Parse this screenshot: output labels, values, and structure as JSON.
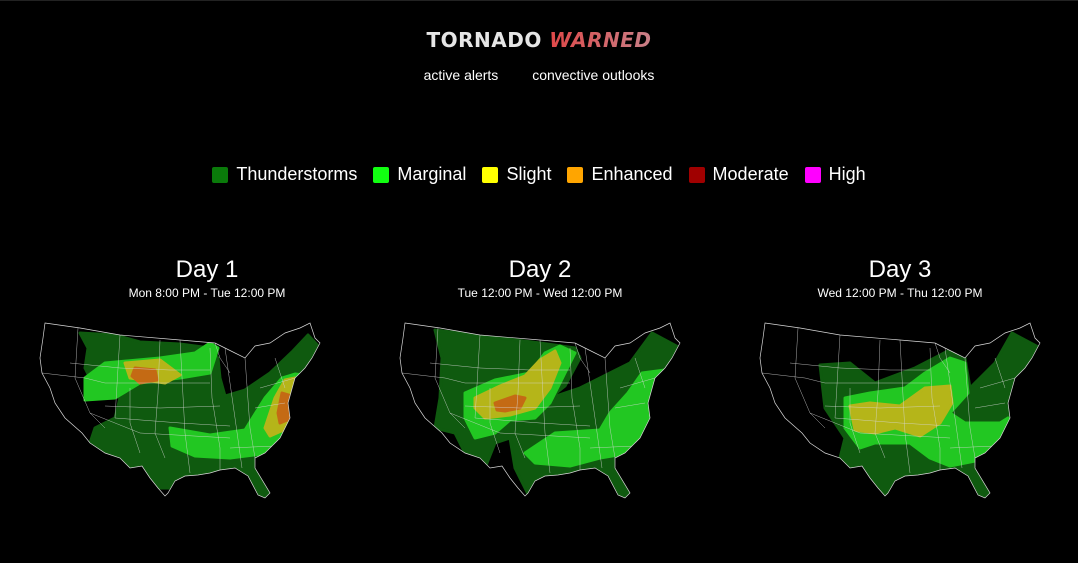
{
  "header": {
    "logo_part1": "TORNADO",
    "logo_part2": "WARNED",
    "nav": [
      {
        "label": "active alerts"
      },
      {
        "label": "convective outlooks"
      }
    ]
  },
  "legend": [
    {
      "label": "Thunderstorms",
      "color": "#0a7a0a"
    },
    {
      "label": "Marginal",
      "color": "#11ff11"
    },
    {
      "label": "Slight",
      "color": "#ffff00"
    },
    {
      "label": "Enhanced",
      "color": "#ffa500"
    },
    {
      "label": "Moderate",
      "color": "#a00000"
    },
    {
      "label": "High",
      "color": "#ff00ff"
    }
  ],
  "map_colors": {
    "thunderstorms": "#0f5a0f",
    "marginal": "#22c722",
    "slight": "#b5b519",
    "enhanced": "#c46a14",
    "moderate": "#a00000",
    "state_lines": "#d8d8d8"
  },
  "days": [
    {
      "title": "Day 1",
      "range": "Mon 8:00 PM - Tue 12:00 PM",
      "regions": {
        "thunderstorms": [
          [
            [
              50,
              15
            ],
            [
              85,
              17
            ],
            [
              110,
              24
            ],
            [
              150,
              26
            ],
            [
              180,
              30
            ],
            [
              188,
              40
            ],
            [
              190,
              60
            ],
            [
              195,
              78
            ],
            [
              215,
              72
            ],
            [
              240,
              55
            ],
            [
              262,
              34
            ],
            [
              278,
              17
            ],
            [
              290,
              30
            ],
            [
              285,
              60
            ],
            [
              270,
              100
            ],
            [
              240,
              140
            ],
            [
              245,
              160
            ],
            [
              240,
              180
            ],
            [
              228,
              185
            ],
            [
              215,
              160
            ],
            [
              190,
              158
            ],
            [
              160,
              158
            ],
            [
              140,
              170
            ],
            [
              115,
              170
            ],
            [
              95,
              165
            ],
            [
              75,
              140
            ],
            [
              55,
              140
            ],
            [
              65,
              110
            ],
            [
              85,
              100
            ],
            [
              90,
              80
            ],
            [
              65,
              70
            ],
            [
              55,
              50
            ],
            [
              58,
              30
            ]
          ]
        ],
        "marginal": [
          [
            [
              75,
              45
            ],
            [
              130,
              40
            ],
            [
              165,
              35
            ],
            [
              180,
              25
            ],
            [
              188,
              30
            ],
            [
              180,
              55
            ],
            [
              150,
              60
            ],
            [
              110,
              65
            ],
            [
              85,
              80
            ],
            [
              55,
              82
            ],
            [
              55,
              60
            ]
          ],
          [
            [
              140,
              110
            ],
            [
              180,
              117
            ],
            [
              215,
              112
            ],
            [
              235,
              80
            ],
            [
              252,
              60
            ],
            [
              265,
              56
            ],
            [
              282,
              58
            ],
            [
              278,
              80
            ],
            [
              265,
              105
            ],
            [
              240,
              135
            ],
            [
              200,
              140
            ],
            [
              165,
              138
            ],
            [
              142,
              128
            ]
          ]
        ],
        "slight": [
          [
            [
              95,
              45
            ],
            [
              130,
              42
            ],
            [
              150,
              57
            ],
            [
              135,
              65
            ],
            [
              100,
              60
            ]
          ],
          [
            [
              235,
              110
            ],
            [
              245,
              80
            ],
            [
              255,
              62
            ],
            [
              265,
              60
            ],
            [
              268,
              85
            ],
            [
              258,
              110
            ],
            [
              240,
              118
            ]
          ]
        ],
        "enhanced": [
          [
            [
              105,
              50
            ],
            [
              125,
              52
            ],
            [
              127,
              62
            ],
            [
              110,
              65
            ],
            [
              102,
              58
            ]
          ],
          [
            [
              248,
              95
            ],
            [
              252,
              75
            ],
            [
              262,
              78
            ],
            [
              262,
              100
            ],
            [
              250,
              105
            ]
          ]
        ],
        "moderate": []
      }
    },
    {
      "title": "Day 2",
      "range": "Tue 12:00 PM - Wed 12:00 PM",
      "regions": {
        "thunderstorms": [
          [
            [
              45,
              12
            ],
            [
              110,
              20
            ],
            [
              150,
              25
            ],
            [
              185,
              30
            ],
            [
              190,
              40
            ],
            [
              175,
              68
            ],
            [
              160,
              80
            ],
            [
              190,
              70
            ],
            [
              220,
              55
            ],
            [
              240,
              45
            ],
            [
              262,
              15
            ],
            [
              290,
              30
            ],
            [
              285,
              60
            ],
            [
              270,
              100
            ],
            [
              250,
              135
            ],
            [
              245,
              160
            ],
            [
              240,
              185
            ],
            [
              225,
              180
            ],
            [
              210,
              158
            ],
            [
              190,
              158
            ],
            [
              175,
              160
            ],
            [
              145,
              175
            ],
            [
              140,
              180
            ],
            [
              125,
              150
            ],
            [
              120,
              120
            ],
            [
              105,
              125
            ],
            [
              95,
              150
            ],
            [
              75,
              135
            ],
            [
              65,
              115
            ],
            [
              45,
              110
            ],
            [
              50,
              80
            ],
            [
              52,
              40
            ]
          ]
        ],
        "marginal": [
          [
            [
              75,
              75
            ],
            [
              105,
              62
            ],
            [
              140,
              55
            ],
            [
              155,
              35
            ],
            [
              170,
              28
            ],
            [
              185,
              35
            ],
            [
              175,
              55
            ],
            [
              160,
              85
            ],
            [
              145,
              100
            ],
            [
              120,
              102
            ],
            [
              105,
              115
            ],
            [
              85,
              120
            ],
            [
              75,
              100
            ]
          ],
          [
            [
              135,
              135
            ],
            [
              165,
              115
            ],
            [
              210,
              112
            ],
            [
              220,
              95
            ],
            [
              238,
              75
            ],
            [
              252,
              55
            ],
            [
              275,
              52
            ],
            [
              270,
              80
            ],
            [
              255,
              110
            ],
            [
              240,
              135
            ],
            [
              210,
              140
            ],
            [
              180,
              148
            ],
            [
              145,
              145
            ]
          ]
        ],
        "slight": [
          [
            [
              85,
              80
            ],
            [
              110,
              68
            ],
            [
              135,
              58
            ],
            [
              150,
              42
            ],
            [
              165,
              33
            ],
            [
              170,
              45
            ],
            [
              160,
              70
            ],
            [
              145,
              90
            ],
            [
              120,
              97
            ],
            [
              95,
              100
            ],
            [
              85,
              90
            ]
          ]
        ],
        "enhanced": [
          [
            [
              105,
              85
            ],
            [
              125,
              78
            ],
            [
              135,
              80
            ],
            [
              130,
              90
            ],
            [
              115,
              93
            ],
            [
              107,
              92
            ]
          ]
        ],
        "moderate": []
      }
    },
    {
      "title": "Day 3",
      "range": "Wed 12:00 PM - Thu 12:00 PM",
      "regions": {
        "thunderstorms": [
          [
            [
              70,
              47
            ],
            [
              100,
              45
            ],
            [
              125,
              65
            ],
            [
              165,
              50
            ],
            [
              200,
              32
            ],
            [
              215,
              40
            ],
            [
              220,
              70
            ],
            [
              230,
              60
            ],
            [
              245,
              45
            ],
            [
              262,
              15
            ],
            [
              290,
              30
            ],
            [
              285,
              60
            ],
            [
              270,
              100
            ],
            [
              250,
              135
            ],
            [
              245,
              160
            ],
            [
              240,
              185
            ],
            [
              225,
              180
            ],
            [
              210,
              158
            ],
            [
              190,
              158
            ],
            [
              175,
              160
            ],
            [
              150,
              180
            ],
            [
              135,
              180
            ],
            [
              120,
              160
            ],
            [
              95,
              150
            ],
            [
              90,
              140
            ],
            [
              95,
              120
            ],
            [
              75,
              90
            ]
          ]
        ],
        "marginal": [
          [
            [
              95,
              80
            ],
            [
              120,
              75
            ],
            [
              155,
              70
            ],
            [
              175,
              55
            ],
            [
              200,
              40
            ],
            [
              215,
              45
            ],
            [
              218,
              75
            ],
            [
              200,
              95
            ],
            [
              215,
              105
            ],
            [
              250,
              105
            ],
            [
              258,
              100
            ],
            [
              265,
              110
            ],
            [
              240,
              140
            ],
            [
              200,
              148
            ],
            [
              180,
              140
            ],
            [
              160,
              125
            ],
            [
              125,
              125
            ],
            [
              110,
              130
            ],
            [
              95,
              110
            ]
          ]
        ],
        "slight": [
          [
            [
              100,
              88
            ],
            [
              120,
              85
            ],
            [
              150,
              88
            ],
            [
              175,
              70
            ],
            [
              200,
              68
            ],
            [
              202,
              85
            ],
            [
              190,
              105
            ],
            [
              170,
              118
            ],
            [
              145,
              110
            ],
            [
              125,
              115
            ],
            [
              105,
              112
            ]
          ]
        ],
        "enhanced": [],
        "moderate": []
      }
    }
  ]
}
